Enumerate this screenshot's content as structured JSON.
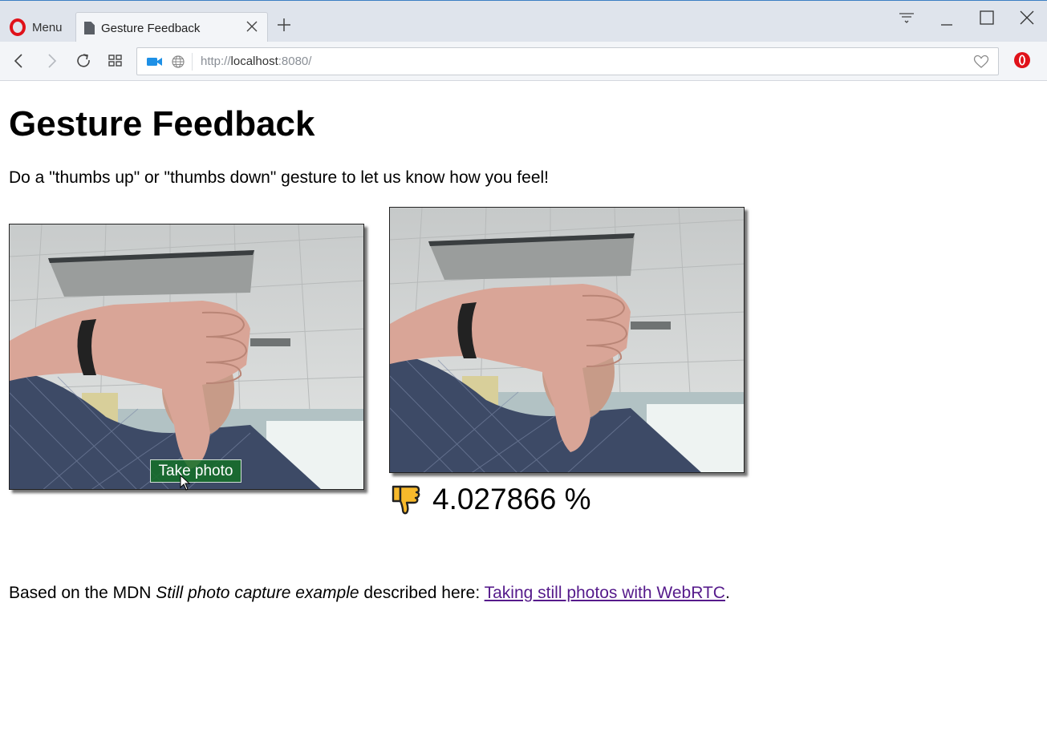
{
  "browser": {
    "menu_label": "Menu",
    "tab_title": "Gesture Feedback",
    "url_scheme": "http://",
    "url_host": "localhost",
    "url_rest": ":8080/",
    "accent_color": "#e0121a",
    "icons": [
      "opera-logo-icon",
      "page-icon",
      "close-icon",
      "plus-icon",
      "tab-menu-icon",
      "minimize-icon",
      "maximize-icon",
      "back-icon",
      "forward-icon",
      "reload-icon",
      "speed-dial-icon",
      "camera-icon",
      "globe-icon",
      "heart-icon",
      "opera-badge-icon"
    ]
  },
  "page": {
    "title": "Gesture Feedback",
    "intro": "Do a \"thumbs up\" or \"thumbs down\" gesture to let us know how you feel!",
    "take_photo_label": "Take photo",
    "result_icon": "thumbs-down-icon",
    "result_value": "4.027866 %",
    "footer_prefix": "Based on the MDN ",
    "footer_italic": "Still photo capture example",
    "footer_middle": " described here: ",
    "footer_link": "Taking still photos with WebRTC",
    "footer_suffix": ".",
    "link_color": "#551a8b",
    "button_color": "#1e7a33"
  }
}
